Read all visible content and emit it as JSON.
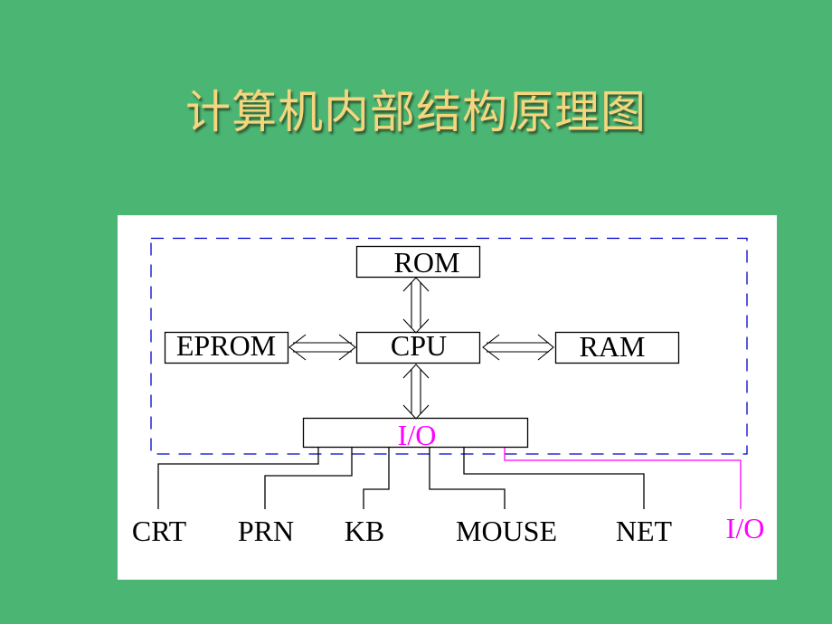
{
  "title": "计算机内部结构原理图",
  "colors": {
    "background": "#4bb574",
    "title": "#f5d67e",
    "panel": "#ffffff",
    "dashed_boundary": "#0000cc",
    "io_accent": "#ff00ff",
    "line": "#000000"
  },
  "diagram": {
    "boxes": {
      "rom": "ROM",
      "cpu": "CPU",
      "eprom": "EPROM",
      "ram": "RAM",
      "io": "I/O"
    },
    "connections": [
      {
        "from": "CPU",
        "to": "ROM",
        "type": "double-arrow"
      },
      {
        "from": "CPU",
        "to": "EPROM",
        "type": "double-arrow"
      },
      {
        "from": "CPU",
        "to": "RAM",
        "type": "double-arrow"
      },
      {
        "from": "CPU",
        "to": "I/O",
        "type": "double-arrow"
      }
    ],
    "devices": [
      "CRT",
      "PRN",
      "KB",
      "MOUSE",
      "NET",
      "I/O"
    ]
  }
}
